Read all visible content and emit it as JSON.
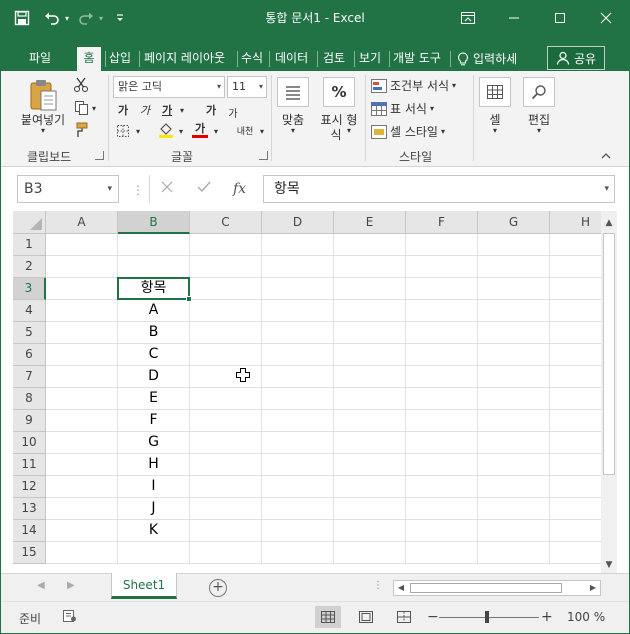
{
  "titlebar": {
    "title": "통합 문서1 - Excel",
    "qat_icons": [
      "save-icon",
      "undo-icon",
      "redo-icon",
      "customize-qat-icon"
    ]
  },
  "tabs": [
    {
      "label": "파일",
      "active": false
    },
    {
      "label": "홈",
      "active": true
    },
    {
      "label": "삽입",
      "active": false
    },
    {
      "label": "페이지 레이아웃",
      "active": false
    },
    {
      "label": "수식",
      "active": false
    },
    {
      "label": "데이터",
      "active": false
    },
    {
      "label": "검토",
      "active": false
    },
    {
      "label": "보기",
      "active": false
    },
    {
      "label": "개발 도구",
      "active": false
    }
  ],
  "tell_me": "입력하세",
  "share": "공유",
  "ribbon": {
    "clipboard": {
      "paste": "붙여넣기",
      "group": "클립보드"
    },
    "font": {
      "name": "맑은 고딕",
      "size": "11",
      "bold": "가",
      "italic": "가",
      "underline": "가",
      "grow": "가",
      "shrink": "가",
      "font_color": "가",
      "phonetic": "내천",
      "group": "글꼴"
    },
    "alignment": {
      "label": "맞춤"
    },
    "number": {
      "label_line1": "표시 형",
      "label_line2": "식",
      "percent": "%"
    },
    "styles": {
      "conditional": "조건부 서식",
      "table": "표 서식",
      "cell_styles": "셀 스타일",
      "group": "스타일"
    },
    "cells": {
      "label": "셀"
    },
    "editing": {
      "label": "편집"
    }
  },
  "formula_bar": {
    "name_box": "B3",
    "formula": "항목"
  },
  "columns": [
    "A",
    "B",
    "C",
    "D",
    "E",
    "F",
    "G",
    "H"
  ],
  "rows": [
    "1",
    "2",
    "3",
    "4",
    "5",
    "6",
    "7",
    "8",
    "9",
    "10",
    "11",
    "12",
    "13",
    "14",
    "15"
  ],
  "cells": {
    "B3": "항목",
    "B4": "A",
    "B5": "B",
    "B6": "C",
    "B7": "D",
    "B8": "E",
    "B9": "F",
    "B10": "G",
    "B11": "H",
    "B12": "I",
    "B13": "J",
    "B14": "K"
  },
  "selected_cell": "B3",
  "sheet_tabs": [
    {
      "label": "Sheet1",
      "active": true
    }
  ],
  "status": {
    "ready": "준비",
    "zoom": "100 %"
  },
  "colors": {
    "accent": "#217346",
    "ribbon_bg": "#f3f3f3"
  }
}
